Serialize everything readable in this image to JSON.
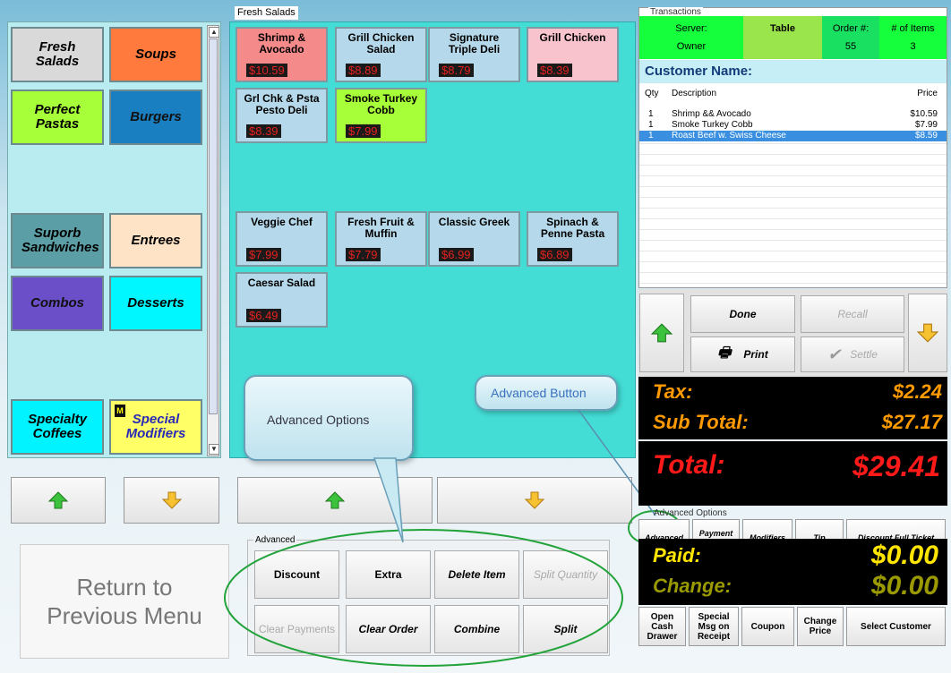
{
  "categories": {
    "items": [
      {
        "label": "Fresh Salads",
        "color": "#d9d9d9"
      },
      {
        "label": "Soups",
        "color": "#ff7a3c"
      },
      {
        "label": "Perfect Pastas",
        "color": "#a6ff38"
      },
      {
        "label": "Burgers",
        "color": "#1a7fc1"
      },
      {
        "label": "Suporb Sandwiches",
        "color": "#5c9ea5"
      },
      {
        "label": "Entrees",
        "color": "#ffe3c6"
      },
      {
        "label": "Combos",
        "color": "#6a4fc9"
      },
      {
        "label": "Desserts",
        "color": "#00f7ff"
      },
      {
        "label": "Specialty Coffees",
        "color": "#00f3ff"
      },
      {
        "label": "Special Modifiers",
        "color": "#ffff66",
        "badge": "M"
      }
    ]
  },
  "items_panel": {
    "label": "Fresh Salads",
    "items": [
      {
        "name": "Shrimp & Avocado",
        "price": "$10.59",
        "color": "#f58a8a"
      },
      {
        "name": "Grill Chicken Salad",
        "price": "$8.89",
        "color": "#b5d9ea"
      },
      {
        "name": "Signature Triple Deli",
        "price": "$8.79",
        "color": "#b5d9ea"
      },
      {
        "name": "Grill Chicken",
        "price": "$8.39",
        "color": "#f9c3cd"
      },
      {
        "name": "Grl Chk & Psta Pesto Deli",
        "price": "$8.39",
        "color": "#b5d9ea"
      },
      {
        "name": "Smoke Turkey Cobb",
        "price": "$7.99",
        "color": "#a6ff38"
      },
      {
        "name": "Veggie Chef",
        "price": "$7.99",
        "color": "#b5d9ea"
      },
      {
        "name": "Fresh Fruit & Muffin",
        "price": "$7.79",
        "color": "#b5d9ea"
      },
      {
        "name": "Classic Greek",
        "price": "$6.99",
        "color": "#b5d9ea"
      },
      {
        "name": "Spinach & Penne Pasta",
        "price": "$6.89",
        "color": "#b5d9ea"
      },
      {
        "name": "Caesar Salad",
        "price": "$6.49",
        "color": "#b5d9ea"
      }
    ]
  },
  "return_button": {
    "label": "Return to Previous Menu"
  },
  "advanced": {
    "label": "Advanced",
    "buttons": [
      {
        "label": "Discount",
        "disabled": false,
        "italic": false
      },
      {
        "label": "Extra",
        "disabled": false,
        "italic": false
      },
      {
        "label": "Delete Item",
        "disabled": false,
        "italic": true
      },
      {
        "label": "Split Quantity",
        "disabled": true,
        "italic": true
      },
      {
        "label": "Clear Payments",
        "disabled": true,
        "italic": false
      },
      {
        "label": "Clear Order",
        "disabled": false,
        "italic": true
      },
      {
        "label": "Combine",
        "disabled": false,
        "italic": true
      },
      {
        "label": "Split",
        "disabled": false,
        "italic": true
      }
    ]
  },
  "callouts": {
    "advanced_options": "Advanced Options",
    "advanced_button": "Advanced Button"
  },
  "transactions": {
    "label": "Transactions",
    "server_label": "Server:",
    "server_value": "Owner",
    "table_label": "Table",
    "order_label": "Order #:",
    "order_value": "55",
    "items_label": "# of Items",
    "items_value": "3",
    "customer_label": "Customer Name:",
    "columns": {
      "qty": "Qty",
      "desc": "Description",
      "price": "Price"
    },
    "rows": [
      {
        "qty": "1",
        "desc": "Shrimp && Avocado",
        "price": "$10.59",
        "selected": false
      },
      {
        "qty": "1",
        "desc": "Smoke Turkey Cobb",
        "price": "$7.99",
        "selected": false
      },
      {
        "qty": "1",
        "desc": "Roast Beef w. Swiss Cheese",
        "price": "$8.59",
        "selected": true
      }
    ]
  },
  "actions": {
    "done": "Done",
    "recall": "Recall",
    "print": "Print",
    "settle": "Settle"
  },
  "totals": {
    "tax_label": "Tax:",
    "tax_value": "$2.24",
    "subtotal_label": "Sub Total:",
    "subtotal_value": "$27.17",
    "total_label": "Total:",
    "total_value": "$29.41",
    "paid_label": "Paid:",
    "paid_value": "$0.00",
    "change_label": "Change:",
    "change_value": "$0.00"
  },
  "advanced_options": {
    "label": "Advanced Options",
    "buttons": [
      "Advanced",
      "Payment Methods",
      "Modifiers",
      "Tip",
      "Discount Full Ticket"
    ]
  },
  "bottom_buttons": [
    "Open Cash Drawer",
    "Special Msg on Receipt",
    "Coupon",
    "Change Price",
    "Select Customer"
  ]
}
